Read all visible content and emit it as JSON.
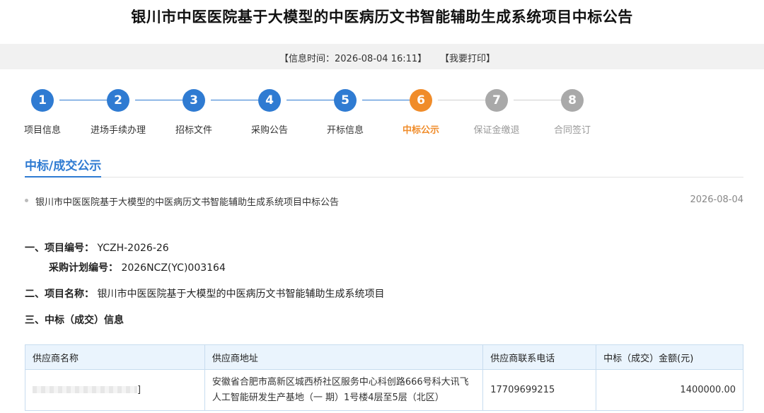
{
  "page": {
    "title": "银川市中医医院基于大模型的中医病历文书智能辅助生成系统项目中标公告"
  },
  "info_bar": {
    "time_text": "【信息时间：2026-08-04 16:11】",
    "print_label": "【我要打印】"
  },
  "steps": [
    {
      "number": "1",
      "label": "项目信息",
      "state": "done"
    },
    {
      "number": "2",
      "label": "进场手续办理",
      "state": "done"
    },
    {
      "number": "3",
      "label": "招标文件",
      "state": "done"
    },
    {
      "number": "4",
      "label": "采购公告",
      "state": "done"
    },
    {
      "number": "5",
      "label": "开标信息",
      "state": "done"
    },
    {
      "number": "6",
      "label": "中标公示",
      "state": "current"
    },
    {
      "number": "7",
      "label": "保证金缴退",
      "state": "pending"
    },
    {
      "number": "8",
      "label": "合同签订",
      "state": "pending"
    }
  ],
  "colors": {
    "done": "#2f7bd2",
    "current": "#f08c2a",
    "pending": "#a9a9a9",
    "pending_label": "#999999",
    "current_label": "#f08c2a"
  },
  "section_tab": {
    "label": "中标/成交公示"
  },
  "notice": {
    "title": "银川市中医医院基于大模型的中医病历文书智能辅助生成系统项目中标公告",
    "date": "2026-08-04"
  },
  "details": {
    "project_no_label": "一、项目编号：",
    "project_no": "YCZH-2026-26",
    "plan_no_label": "采购计划编号：",
    "plan_no": "2026NCZ(YC)003164",
    "project_name_label": "二、项目名称：",
    "project_name": "银川市中医医院基于大模型的中医病历文书智能辅助生成系统项目",
    "winner_heading": "三、中标（成交）信息"
  },
  "table": {
    "headers": [
      "供应商名称",
      "供应商地址",
      "供应商联系电话",
      "中标（成交）金额(元)"
    ],
    "rows": [
      {
        "name_suffix": "]",
        "address": "安徽省合肥市高新区城西桥社区服务中心科创路666号科大讯飞人工智能研发生产基地（一 期）1号楼4层至5层（北区）",
        "phone": "17709699215",
        "amount": "1400000.00"
      }
    ]
  }
}
